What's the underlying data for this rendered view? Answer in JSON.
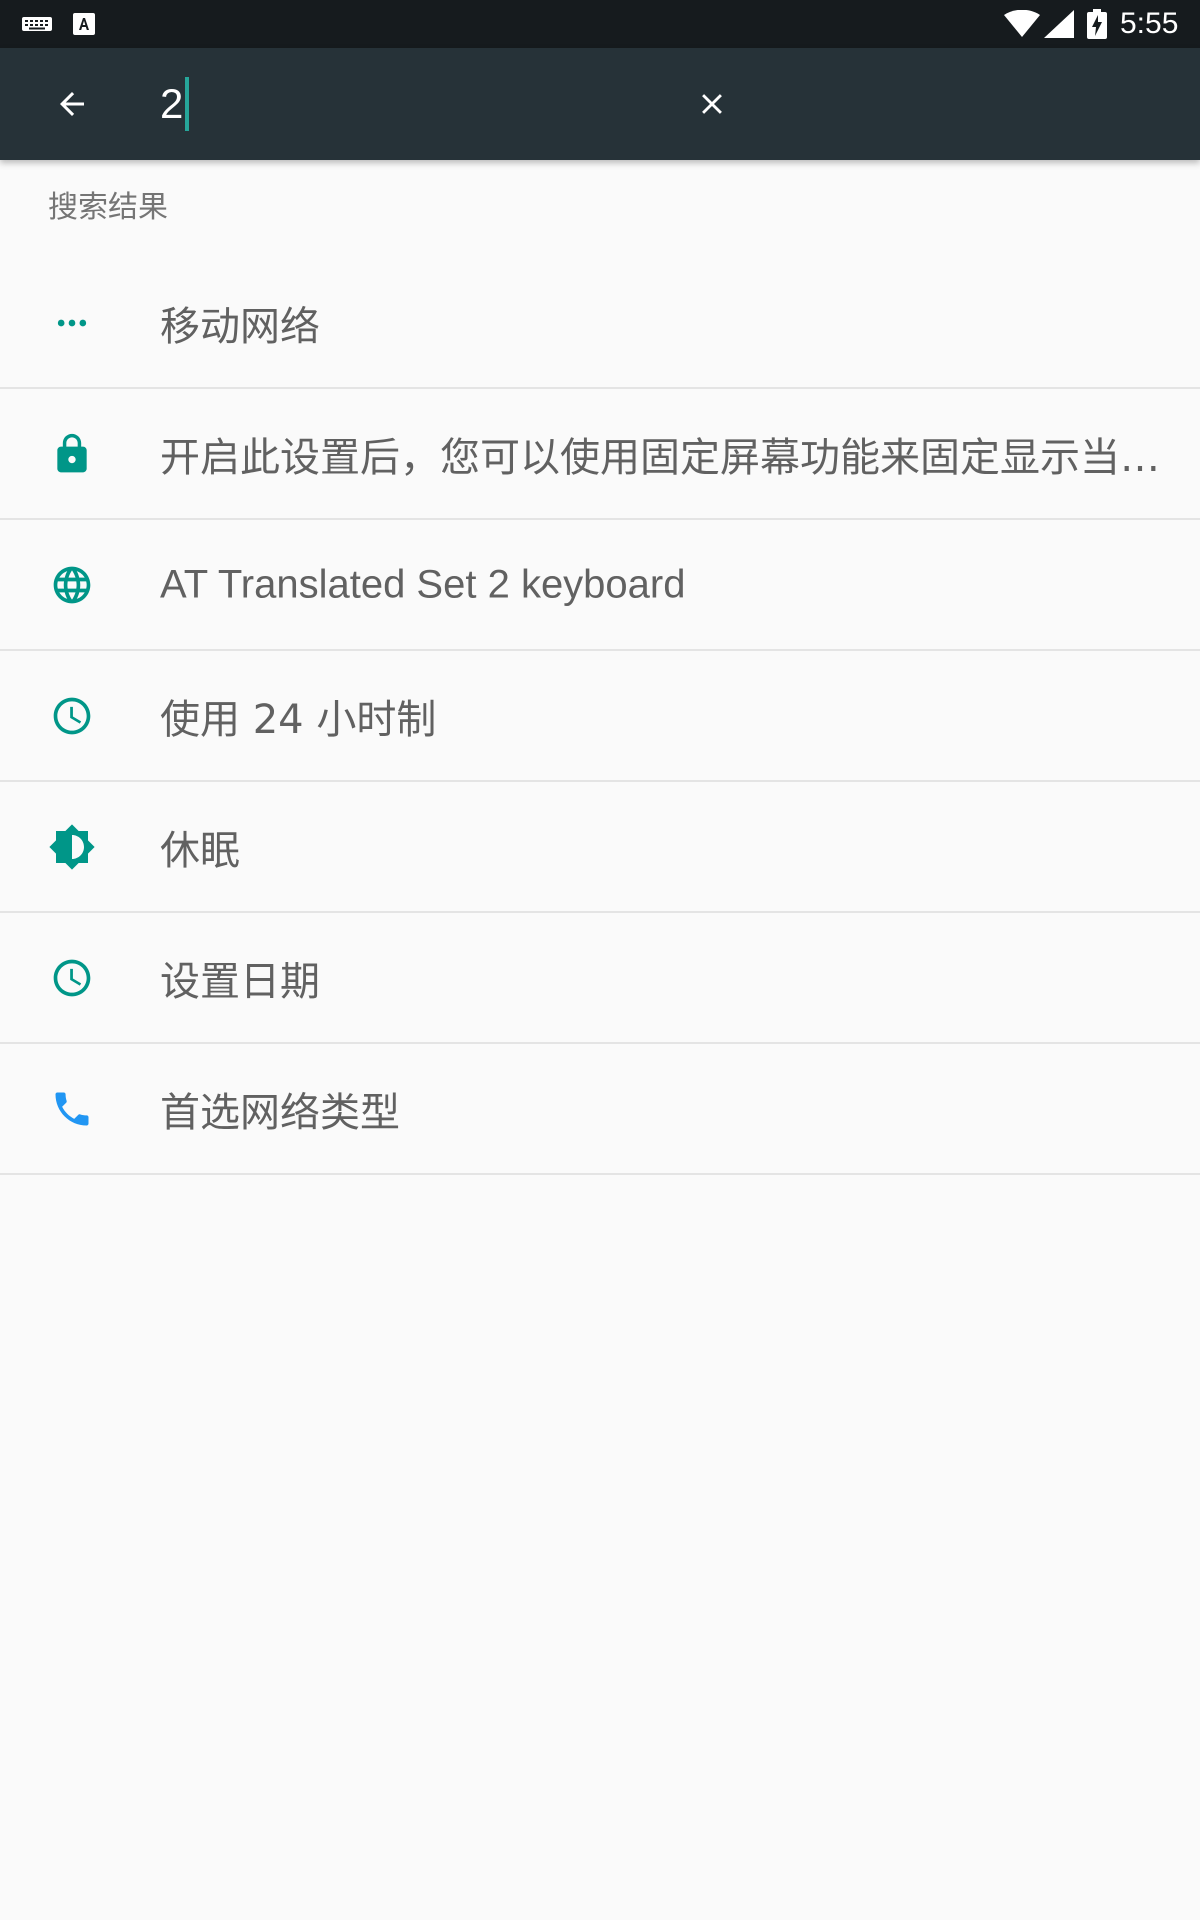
{
  "status_bar": {
    "time": "5:55",
    "icons": [
      "keyboard-icon",
      "text-a-icon",
      "wifi-icon",
      "signal-icon",
      "battery-charging-icon"
    ]
  },
  "search": {
    "query": "2",
    "back_icon": "arrow-back-icon",
    "clear_icon": "close-icon"
  },
  "results_header": "搜索结果",
  "results": [
    {
      "icon": "more-horiz-icon",
      "label": "移动网络"
    },
    {
      "icon": "lock-icon",
      "label": "开启此设置后，您可以使用固定屏幕功能来固定显示当前屏幕"
    },
    {
      "icon": "globe-icon",
      "label": "AT Translated Set 2 keyboard"
    },
    {
      "icon": "clock-icon",
      "label": "使用 24 小时制"
    },
    {
      "icon": "brightness-icon",
      "label": "休眠"
    },
    {
      "icon": "clock-icon",
      "label": "设置日期"
    },
    {
      "icon": "phone-icon",
      "label": "首选网络类型"
    }
  ],
  "colors": {
    "accent": "#009688",
    "toolbar": "#263238",
    "statusbar": "#161b1e",
    "phone": "#2196f3",
    "caret": "#26a69a"
  }
}
